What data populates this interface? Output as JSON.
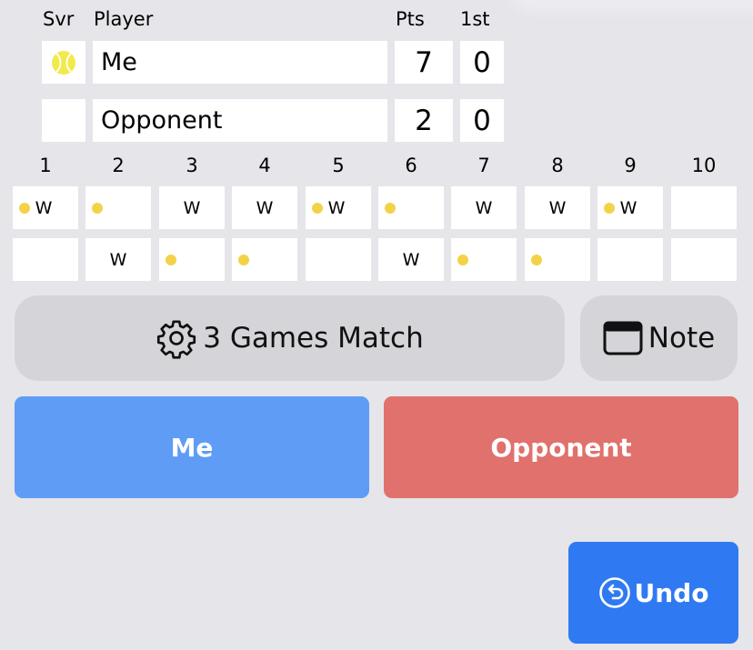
{
  "headers": {
    "svr": "Svr",
    "player": "Player",
    "pts": "Pts",
    "first": "1st"
  },
  "players": [
    {
      "name": "Me",
      "pts": "7",
      "first": "0",
      "serving": true
    },
    {
      "name": "Opponent",
      "pts": "2",
      "first": "0",
      "serving": false
    }
  ],
  "games": [
    {
      "num": "1",
      "top": "W",
      "topDot": true,
      "bot": "",
      "botDot": false
    },
    {
      "num": "2",
      "top": "",
      "topDot": true,
      "bot": "W",
      "botDot": false
    },
    {
      "num": "3",
      "top": "W",
      "topDot": false,
      "bot": "",
      "botDot": true
    },
    {
      "num": "4",
      "top": "W",
      "topDot": false,
      "bot": "",
      "botDot": true
    },
    {
      "num": "5",
      "top": "W",
      "topDot": true,
      "bot": "",
      "botDot": false
    },
    {
      "num": "6",
      "top": "",
      "topDot": true,
      "bot": "W",
      "botDot": false
    },
    {
      "num": "7",
      "top": "W",
      "topDot": false,
      "bot": "",
      "botDot": true
    },
    {
      "num": "8",
      "top": "W",
      "topDot": false,
      "bot": "",
      "botDot": true
    },
    {
      "num": "9",
      "top": "W",
      "topDot": true,
      "bot": "",
      "botDot": false
    },
    {
      "num": "10",
      "top": "",
      "topDot": false,
      "bot": "",
      "botDot": false
    }
  ],
  "buttons": {
    "match": "3 Games Match",
    "note": "Note",
    "me": "Me",
    "opponent": "Opponent",
    "undo": "Undo"
  },
  "icons": {
    "serve": "tennis-ball-icon",
    "settings": "gear-icon",
    "note": "window-icon",
    "undo": "undo-circle-icon"
  },
  "colors": {
    "background": "#e6e5ea",
    "me": "#5f9cf5",
    "opponent": "#e0716c",
    "undo": "#2f7af2",
    "dot": "#f4d248",
    "ball": "#f2ea4c"
  }
}
